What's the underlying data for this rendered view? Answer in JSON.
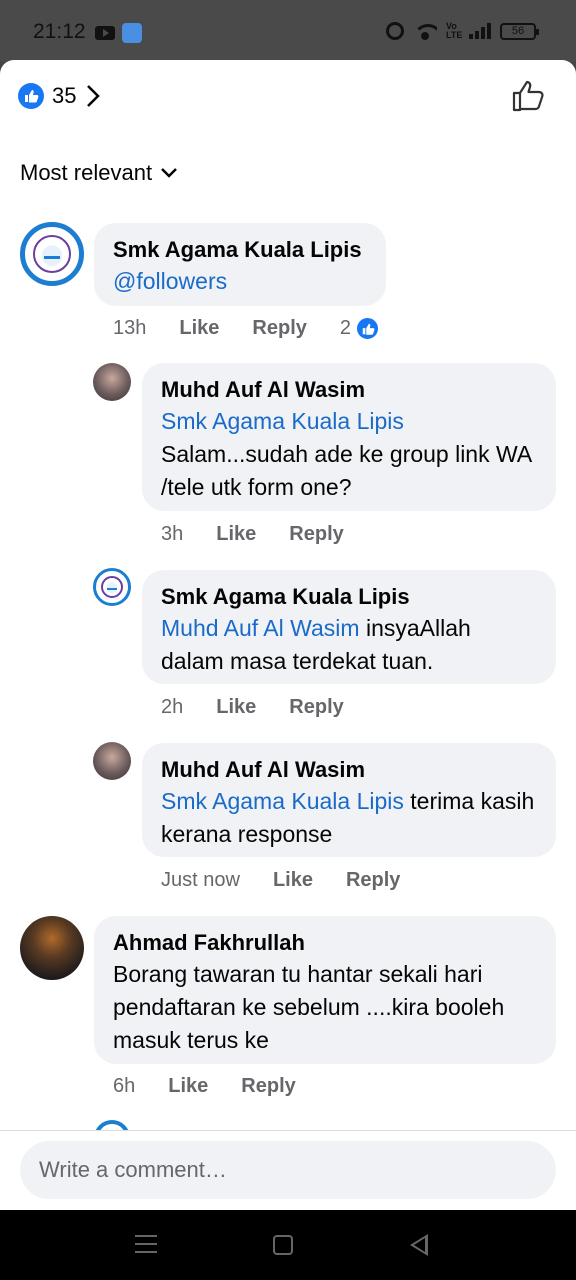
{
  "status_bar": {
    "time": "21:12",
    "battery": "56"
  },
  "reactions": {
    "count": "35"
  },
  "sort": {
    "label": "Most relevant"
  },
  "comments": [
    {
      "author": "Smk Agama Kuala Lipis",
      "mention": "@followers",
      "text": "",
      "time": "13h",
      "like_label": "Like",
      "reply_label": "Reply",
      "reaction_count": "2"
    },
    {
      "author": "Muhd Auf Al Wasim",
      "mention": "Smk Agama Kuala Lipis",
      "text": "Salam...sudah ade ke group link WA /tele utk form one?",
      "time": "3h",
      "like_label": "Like",
      "reply_label": "Reply"
    },
    {
      "author": "Smk Agama Kuala Lipis",
      "mention": "Muhd Auf Al Wasim",
      "text": " insyaAllah dalam masa terdekat tuan.",
      "time": "2h",
      "like_label": "Like",
      "reply_label": "Reply"
    },
    {
      "author": "Muhd Auf Al Wasim",
      "mention": "Smk Agama Kuala Lipis",
      "text": " terima kasih kerana response",
      "time": "Just now",
      "like_label": "Like",
      "reply_label": "Reply"
    },
    {
      "author": "Ahmad Fakhrullah",
      "mention": "",
      "text": "Borang tawaran tu hantar sekali hari pendaftaran ke sebelum ....kira booleh masuk terus ke",
      "time": "6h",
      "like_label": "Like",
      "reply_label": "Reply"
    }
  ],
  "composer": {
    "placeholder": "Write a comment…"
  },
  "colors": {
    "accent": "#1877f2",
    "mention": "#1a6bc9",
    "bubble": "#f0f2f5"
  }
}
